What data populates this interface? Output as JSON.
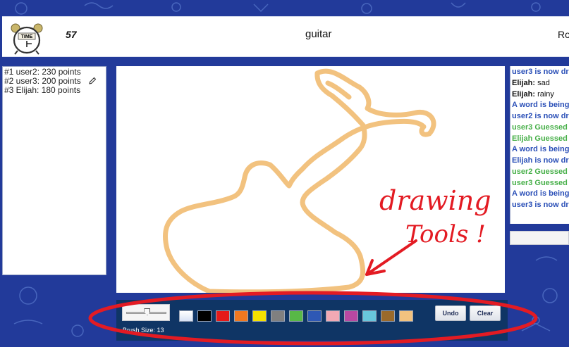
{
  "header": {
    "timer": "57",
    "word": "guitar",
    "round_label": "Ro",
    "clock_text": "TIME"
  },
  "scoreboard": [
    {
      "text": "#1 user2: 230 points"
    },
    {
      "text": "#2 user3: 200 points",
      "is_drawing": true
    },
    {
      "text": "#3 Elijah: 180 points"
    }
  ],
  "chat": {
    "messages": [
      {
        "type": "system",
        "text": "user3 is now dr"
      },
      {
        "type": "user",
        "name": "Elijah:",
        "text": " sad"
      },
      {
        "type": "user",
        "name": "Elijah:",
        "text": " rainy"
      },
      {
        "type": "system",
        "text": "A word is being"
      },
      {
        "type": "system",
        "text": "user2 is now dr"
      },
      {
        "type": "guess",
        "text": "user3 Guessed t"
      },
      {
        "type": "guess",
        "text": "Elijah Guessed t"
      },
      {
        "type": "system",
        "text": "A word is being"
      },
      {
        "type": "system",
        "text": "Elijah is now dr"
      },
      {
        "type": "guess",
        "text": "user2 Guessed t"
      },
      {
        "type": "guess",
        "text": "user3 Guessed t"
      },
      {
        "type": "system",
        "text": "A word is being"
      },
      {
        "type": "system",
        "text": "user3 is now dr"
      }
    ]
  },
  "toolbar": {
    "brush_size_label": "Brush Size: 13",
    "brush_size_fraction": 0.53,
    "undo_label": "Undo",
    "clear_label": "Clear",
    "colors": [
      "#ffffff",
      "#000000",
      "#e51a1a",
      "#f07820",
      "#f5e100",
      "#808080",
      "#58b847",
      "#2e58b5",
      "#f1a9b4",
      "#b848a2",
      "#68c6dc",
      "#9b6a2b",
      "#f2c27f"
    ]
  },
  "annotation": {
    "line1": "drawing",
    "line2": "Tools !",
    "color": "#e31b23"
  },
  "colors": {
    "background": "#223a9a",
    "guitar_stroke": "#f2c27f",
    "system_msg": "#2a4fb7",
    "guess_msg": "#48b04a"
  }
}
